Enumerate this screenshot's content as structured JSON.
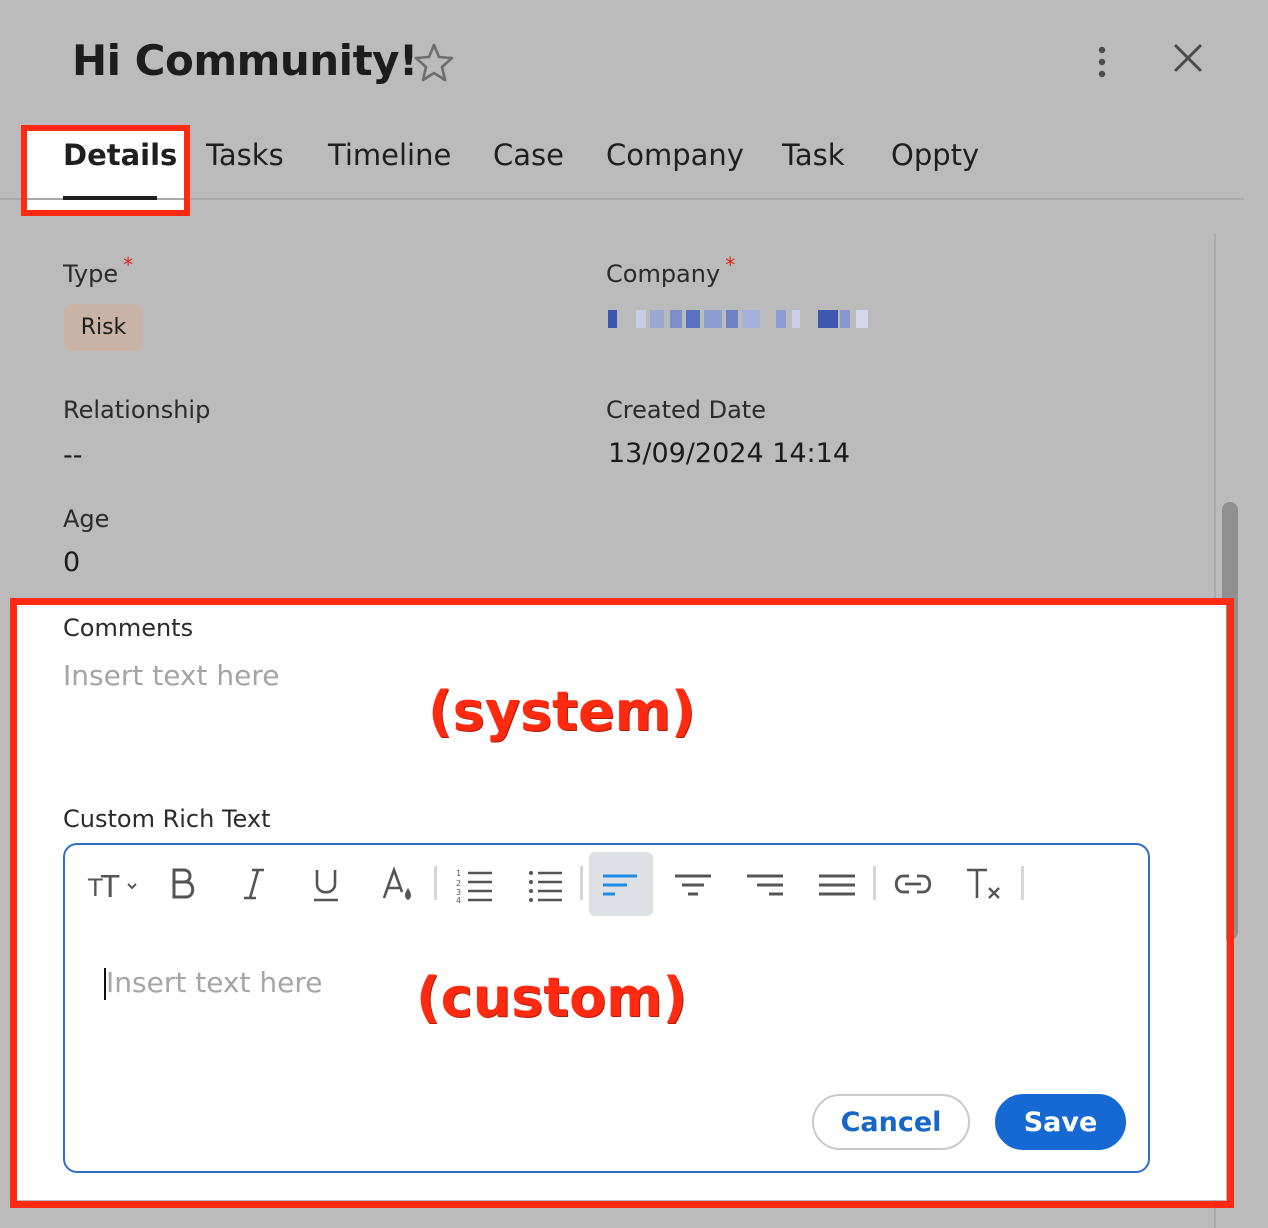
{
  "header": {
    "title": "Hi Community!"
  },
  "tabs": [
    {
      "label": "Details",
      "active": true
    },
    {
      "label": "Tasks"
    },
    {
      "label": "Timeline"
    },
    {
      "label": "Case"
    },
    {
      "label": "Company"
    },
    {
      "label": "Task"
    },
    {
      "label": "Oppty"
    }
  ],
  "fields": {
    "type": {
      "label": "Type",
      "required": "*",
      "value": "Risk"
    },
    "company": {
      "label": "Company",
      "required": "*"
    },
    "relationship": {
      "label": "Relationship",
      "value": "--"
    },
    "created_date": {
      "label": "Created Date",
      "value": "13/09/2024 14:14"
    },
    "age": {
      "label": "Age",
      "value": "0"
    },
    "comments": {
      "label": "Comments",
      "placeholder": "Insert text here"
    },
    "custom_rich_text": {
      "label": "Custom Rich Text",
      "placeholder": "Insert text here"
    }
  },
  "annotations": {
    "system": "(system)",
    "custom": "(custom)"
  },
  "editor": {
    "toolbar": [
      "font-size-icon",
      "bold-icon",
      "italic-icon",
      "underline-icon",
      "text-color-icon",
      "numbered-list-icon",
      "bulleted-list-icon",
      "align-left-icon",
      "align-center-icon",
      "align-right-icon",
      "align-justify-icon",
      "link-icon",
      "clear-format-icon"
    ],
    "active_tool": "align-left-icon",
    "cancel_label": "Cancel",
    "save_label": "Save"
  },
  "colors": {
    "highlight": "#ff2a0f",
    "primary": "#1669d3",
    "badge": "#c9b3a6",
    "overlay": "#bbbbbb"
  }
}
